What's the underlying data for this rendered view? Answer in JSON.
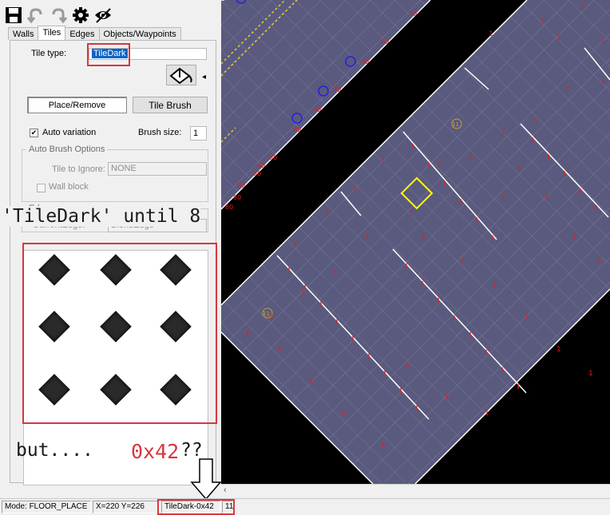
{
  "tabs": [
    "Walls",
    "Tiles",
    "Edges",
    "Objects/Waypoints"
  ],
  "tile_type_label": "Tile type:",
  "tile_type_value": "TileDark",
  "place_remove_label": "Place/Remove",
  "tile_brush_label": "Tile Brush",
  "auto_variation_label": "Auto variation",
  "brush_size_label": "Brush size:",
  "brush_size_value": "1",
  "auto_brush_options_title": "Auto Brush Options",
  "tile_to_ignore_label": "Tile to Ignore:",
  "tile_to_ignore_value": "NONE",
  "wall_block_label": "Wall block",
  "edges_group_title": "Edges",
  "current_edge_label": "CurrentEdge:",
  "current_edge_value": "BlendEdge",
  "annotation_top": "'TileDark' until 8",
  "annotation_but": "but....",
  "annotation_hex": "0x42",
  "annotation_qq": "??",
  "status_mode": "Mode: FLOOR_PLACE",
  "status_coords": "X=220 Y=226",
  "status_tile": "TileDark-0x42",
  "status_num": "11",
  "map_numbers": {
    "one": "1",
    "eighty": "80",
    "eleven": "11"
  },
  "colors": {
    "floor": "#5a5a7e",
    "highlight": "#0a64c8",
    "annotation_red": "#d9363e"
  }
}
